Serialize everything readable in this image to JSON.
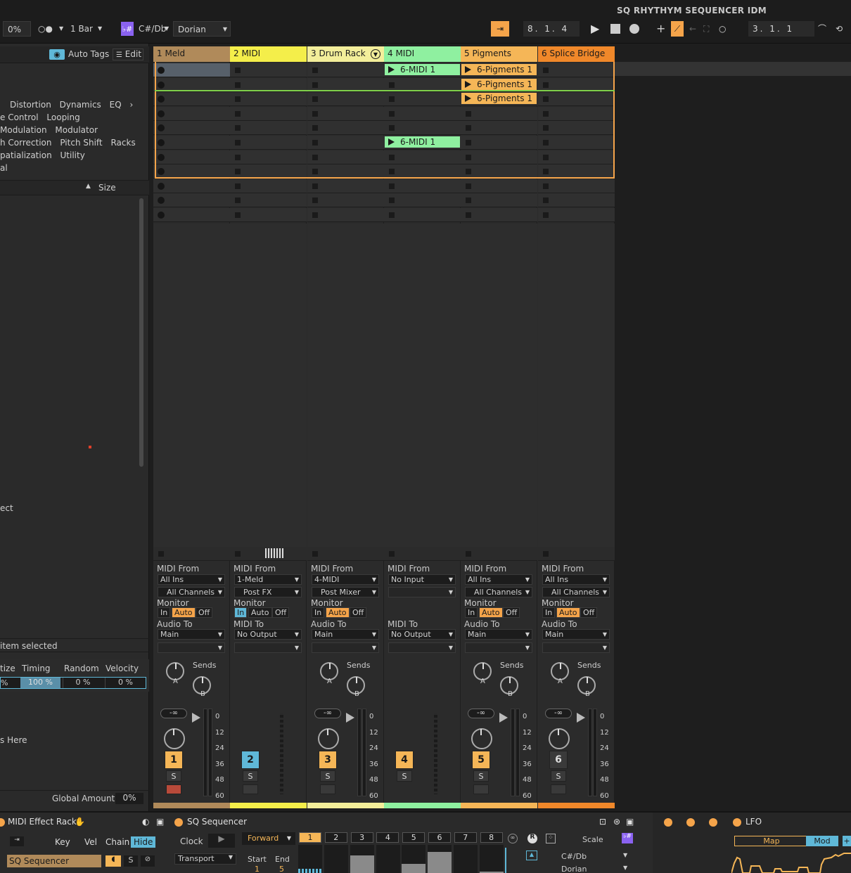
{
  "project_title": "SQ RHYTHYM SEQUENCER IDM",
  "topbar": {
    "groove": "0%",
    "follow": "○●",
    "quantize": "1 Bar",
    "scale_key": "C#/Db",
    "scale_mode": "Dorian",
    "arrangement_position": "8.  1.  4",
    "loop_position": "3.  1.  1"
  },
  "browser": {
    "auto_tags": "Auto Tags",
    "edit": "Edit",
    "tag_rows": [
      [
        "Distortion",
        "Dynamics",
        "EQ"
      ],
      [
        "e Control",
        "Looping"
      ],
      [
        "Modulation",
        "Modulator"
      ],
      [
        "h Correction",
        "Pitch Shift",
        "Racks"
      ],
      [
        "patialization",
        "Utility"
      ],
      [
        "al"
      ]
    ],
    "size_header": "Size",
    "ect_text": "ect",
    "item_selected": "item selected",
    "groove_headers": [
      "tize",
      "Timing",
      "Random",
      "Velocity"
    ],
    "groove_values": [
      "%",
      "100 %",
      "0 %",
      "0 %"
    ],
    "drop_here": "s Here",
    "global_amount_label": "Global Amount",
    "global_amount_value": "0%"
  },
  "tracks": [
    {
      "name": "1 Meld",
      "color": "#b08a5a",
      "num": "1",
      "num_color": "#f5b657",
      "midi_from": "All Ins",
      "channel": "All Channels",
      "monitor": "Auto",
      "out_label": "Audio To",
      "out": "Main",
      "sends": true,
      "sends_label": "Sends",
      "vol": "-∞",
      "foot": "#b08a5a",
      "clips": []
    },
    {
      "name": "2 MIDI",
      "color": "#f4ee4a",
      "num": "2",
      "num_color": "#5fb8d8",
      "midi_from": "1-Meld",
      "channel": "Post FX",
      "monitor": "In",
      "out_label": "MIDI To",
      "out": "No Output",
      "sends": false,
      "foot": "#f4ee4a",
      "clips": []
    },
    {
      "name": "3 Drum Rack",
      "color": "#f3ee9a",
      "num": "3",
      "num_color": "#f5b657",
      "midi_from": "4-MIDI",
      "channel": "Post Mixer",
      "monitor": "Auto",
      "out_label": "Audio To",
      "out": "Main",
      "sends": true,
      "sends_label": "Sends",
      "vol": "-∞",
      "foot": "#f3ee9a",
      "clips": []
    },
    {
      "name": "4 MIDI",
      "color": "#8ff0a0",
      "num": "4",
      "num_color": "#f5b657",
      "midi_from": "No Input",
      "channel": "",
      "monitor": "",
      "out_label": "MIDI To",
      "out": "No Output",
      "sends": false,
      "foot": "#8ff0a0",
      "clips": [
        {
          "slot": 0,
          "name": "6-MIDI 1"
        },
        {
          "slot": 5,
          "name": "6-MIDI 1"
        }
      ]
    },
    {
      "name": "5 Pigments",
      "color": "#f5b657",
      "num": "5",
      "num_color": "#f5b657",
      "midi_from": "All Ins",
      "channel": "All Channels",
      "monitor": "Auto",
      "out_label": "Audio To",
      "out": "Main",
      "sends": true,
      "sends_label": "Sends",
      "vol": "-∞",
      "foot": "#f5b657",
      "clips": [
        {
          "slot": 0,
          "name": "6-Pigments 1"
        },
        {
          "slot": 1,
          "name": "6-Pigments 1"
        },
        {
          "slot": 2,
          "name": "6-Pigments 1"
        }
      ]
    },
    {
      "name": "6 Splice Bridge",
      "color": "#f0882a",
      "num": "6",
      "num_color": "#3a3a3a",
      "midi_from": "All Ins",
      "channel": "All Channels",
      "monitor": "Auto",
      "out_label": "Audio To",
      "out": "Main",
      "sends": true,
      "sends_label": "Sends",
      "vol": "-∞",
      "foot": "#f0882a",
      "clips": []
    }
  ],
  "io_labels": {
    "midi_from": "MIDI From",
    "monitor": "Monitor",
    "in": "In",
    "auto": "Auto",
    "off": "Off",
    "solo": "S",
    "knob_a": "A",
    "knob_b": "B"
  },
  "db_scale": [
    "0",
    "12",
    "24",
    "36",
    "48",
    "60"
  ],
  "devices": {
    "rack_title": "MIDI Effect Rack",
    "key": "Key",
    "vel": "Vel",
    "chain": "Chain",
    "hide": "Hide",
    "chain_name": "SQ Sequencer",
    "seq_title": "SQ Sequencer",
    "clock": "Clock",
    "transport": "Transport",
    "direction": "Forward",
    "steps": [
      "1",
      "2",
      "3",
      "4",
      "5",
      "6",
      "7",
      "8"
    ],
    "start_label": "Start",
    "start_value": "1",
    "end_label": "End",
    "end_value": "5",
    "r_label": "R",
    "scale_label": "Scale",
    "scale_key": "C#/Db",
    "scale_mode": "Dorian",
    "lfo_title": "LFO",
    "map": "Map",
    "mod": "Mod"
  }
}
